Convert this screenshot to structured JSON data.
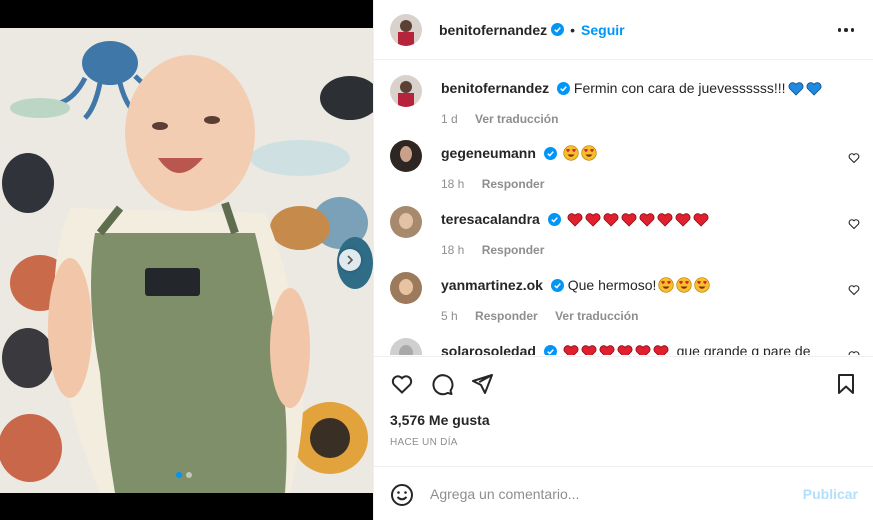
{
  "post": {
    "author": "benitofernandez",
    "follow_label": "Seguir",
    "separator": "•"
  },
  "caption": {
    "user": "benitofernandez",
    "text": "Fermin con cara de juevessssss!!!",
    "time": "1 d",
    "translate": "Ver traducción"
  },
  "comments": [
    {
      "user": "gegeneumann",
      "text": "",
      "emojis": [
        "heart-eyes",
        "heart-eyes"
      ],
      "time": "18 h",
      "reply": "Responder",
      "translate": ""
    },
    {
      "user": "teresacalandra",
      "text": "",
      "emojis": [
        "red-heart",
        "red-heart",
        "red-heart",
        "red-heart",
        "red-heart",
        "red-heart",
        "red-heart",
        "red-heart"
      ],
      "time": "18 h",
      "reply": "Responder",
      "translate": ""
    },
    {
      "user": "yanmartinez.ok",
      "text": "Que hermoso!",
      "emojis": [
        "heart-eyes",
        "heart-eyes",
        "heart-eyes"
      ],
      "time": "5 h",
      "reply": "Responder",
      "translate": "Ver traducción"
    },
    {
      "user": "solarosoledad",
      "text": "que grande q pare de",
      "emojis": [
        "red-heart",
        "red-heart",
        "red-heart",
        "red-heart",
        "red-heart",
        "red-heart"
      ],
      "time": "",
      "reply": "",
      "translate": ""
    }
  ],
  "stats": {
    "likes": "3,576 Me gusta",
    "date": "HACE UN DÍA"
  },
  "composer": {
    "placeholder": "Agrega un comentario...",
    "publish": "Publicar"
  },
  "colors": {
    "accent": "#0095f6",
    "publish_disabled": "#b2dffc",
    "verified": "#0095f6",
    "meta": "#8e8e8e"
  },
  "carousel": {
    "current": 1,
    "total": 2
  }
}
